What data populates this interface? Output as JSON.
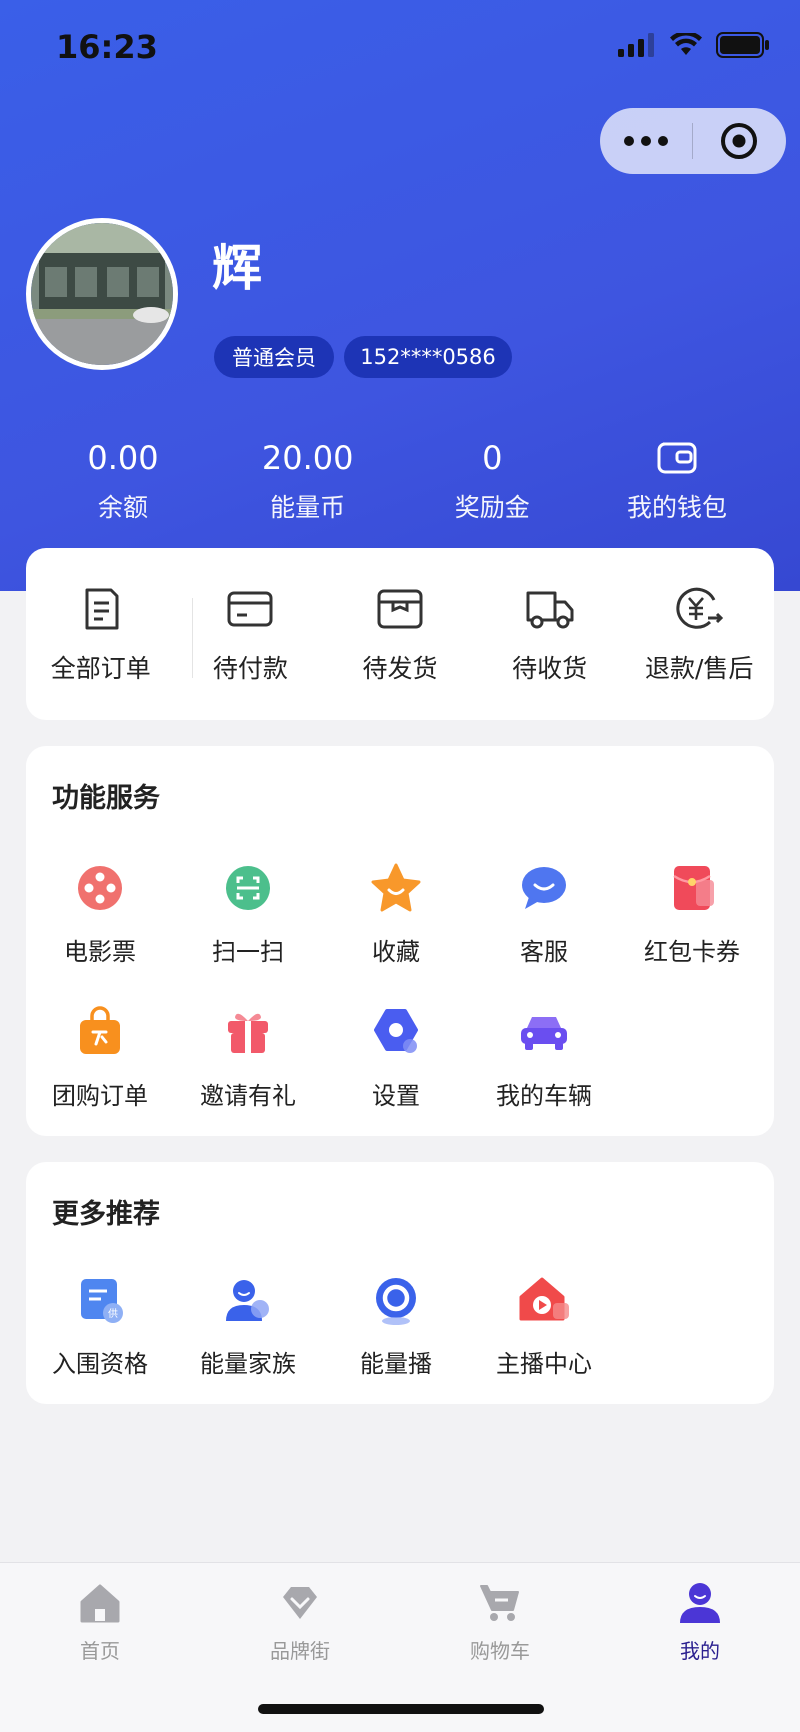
{
  "status_bar": {
    "time": "16:23"
  },
  "profile": {
    "name": "辉",
    "member_level": "普通会员",
    "phone": "152****0586"
  },
  "stats": [
    {
      "value": "0.00",
      "label": "余额"
    },
    {
      "value": "20.00",
      "label": "能量币"
    },
    {
      "value": "0",
      "label": "奖励金"
    },
    {
      "value": "",
      "label": "我的钱包",
      "icon": "wallet-icon"
    }
  ],
  "orders": [
    {
      "label": "全部订单",
      "icon": "order-list-icon"
    },
    {
      "label": "待付款",
      "icon": "card-icon"
    },
    {
      "label": "待发货",
      "icon": "box-icon"
    },
    {
      "label": "待收货",
      "icon": "truck-icon"
    },
    {
      "label": "退款/售后",
      "icon": "refund-icon"
    }
  ],
  "services": {
    "title": "功能服务",
    "items": [
      {
        "label": "电影票",
        "icon": "film-reel-icon",
        "color": "#f0716e"
      },
      {
        "label": "扫一扫",
        "icon": "scan-icon",
        "color": "#4cbf8c"
      },
      {
        "label": "收藏",
        "icon": "star-icon",
        "color": "#f8982b"
      },
      {
        "label": "客服",
        "icon": "chat-icon",
        "color": "#4f76f0"
      },
      {
        "label": "红包卡券",
        "icon": "red-envelope-icon",
        "color": "#f04a5a"
      },
      {
        "label": "团购订单",
        "icon": "shopping-bag-icon",
        "color": "#f8901e"
      },
      {
        "label": "邀请有礼",
        "icon": "gift-icon",
        "color": "#f2596a"
      },
      {
        "label": "设置",
        "icon": "settings-icon",
        "color": "#4a5df0"
      },
      {
        "label": "我的车辆",
        "icon": "car-icon",
        "color": "#6a4ef0"
      }
    ]
  },
  "recommend": {
    "title": "更多推荐",
    "items": [
      {
        "label": "入围资格",
        "icon": "document-icon",
        "color": "#4f86f0"
      },
      {
        "label": "能量家族",
        "icon": "user-group-icon",
        "color": "#3a62ea"
      },
      {
        "label": "能量播",
        "icon": "live-ring-icon",
        "color": "#3a62ea"
      },
      {
        "label": "主播中心",
        "icon": "house-play-icon",
        "color": "#f04a4a"
      }
    ]
  },
  "tabbar": [
    {
      "label": "首页",
      "icon": "home-icon",
      "active": false
    },
    {
      "label": "品牌街",
      "icon": "heart-tag-icon",
      "active": false
    },
    {
      "label": "购物车",
      "icon": "cart-icon",
      "active": false
    },
    {
      "label": "我的",
      "icon": "user-icon",
      "active": true
    }
  ],
  "colors": {
    "header_blue": "#3a5fe8",
    "badge_blue": "#1d34b6",
    "active_tab": "#2a1f8f"
  }
}
